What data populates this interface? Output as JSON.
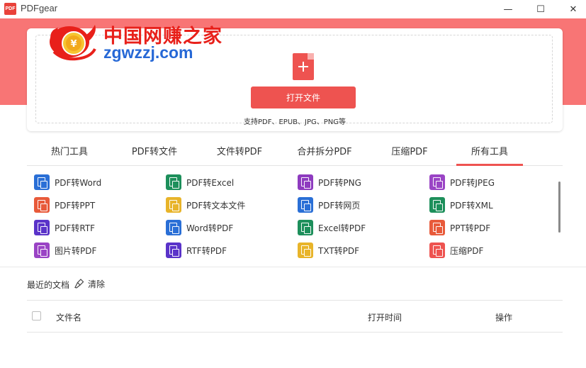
{
  "window": {
    "logo_text": "PDF",
    "title": "PDFgear",
    "minimize": "—",
    "maximize": "☐",
    "close": "✕"
  },
  "watermark": {
    "line1": "中国网赚之家",
    "line2": "zgwzzj.com"
  },
  "upload": {
    "open_button": "打开文件",
    "support_text": "支持PDF、EPUB、JPG、PNG等"
  },
  "tabs": [
    {
      "label": "热门工具"
    },
    {
      "label": "PDF转文件"
    },
    {
      "label": "文件转PDF"
    },
    {
      "label": "合并拆分PDF"
    },
    {
      "label": "压缩PDF"
    },
    {
      "label": "所有工具",
      "active": true
    }
  ],
  "tools": [
    {
      "label": "PDF转Word",
      "icon": "pdf-to-word-icon",
      "color": "#2a6fd6"
    },
    {
      "label": "PDF转Excel",
      "icon": "pdf-to-excel-icon",
      "color": "#1d8f5b"
    },
    {
      "label": "PDF转PNG",
      "icon": "pdf-to-png-icon",
      "color": "#8e3bbf"
    },
    {
      "label": "PDF转JPEG",
      "icon": "pdf-to-jpeg-icon",
      "color": "#9a44c5"
    },
    {
      "label": "PDF转PPT",
      "icon": "pdf-to-ppt-icon",
      "color": "#e85a3a"
    },
    {
      "label": "PDF转文本文件",
      "icon": "pdf-to-text-icon",
      "color": "#e8b42a"
    },
    {
      "label": "PDF转网页",
      "icon": "pdf-to-html-icon",
      "color": "#2a6fd6"
    },
    {
      "label": "PDF转XML",
      "icon": "pdf-to-xml-icon",
      "color": "#1d8f5b"
    },
    {
      "label": "PDF转RTF",
      "icon": "pdf-to-rtf-icon",
      "color": "#5a33c9"
    },
    {
      "label": "Word转PDF",
      "icon": "word-to-pdf-icon",
      "color": "#2a6fd6"
    },
    {
      "label": "Excel转PDF",
      "icon": "excel-to-pdf-icon",
      "color": "#1d8f5b"
    },
    {
      "label": "PPT转PDF",
      "icon": "ppt-to-pdf-icon",
      "color": "#e85a3a"
    },
    {
      "label": "图片转PDF",
      "icon": "image-to-pdf-icon",
      "color": "#9a44c5"
    },
    {
      "label": "RTF转PDF",
      "icon": "rtf-to-pdf-icon",
      "color": "#5a33c9"
    },
    {
      "label": "TXT转PDF",
      "icon": "txt-to-pdf-icon",
      "color": "#e8b42a"
    },
    {
      "label": "压缩PDF",
      "icon": "compress-pdf-icon",
      "color": "#ee5350"
    }
  ],
  "recent": {
    "label": "最近的文档",
    "clear": "清除",
    "columns": {
      "filename": "文件名",
      "open_time": "打开时间",
      "actions": "操作"
    }
  },
  "colors": {
    "accent": "#ee5350",
    "banner": "#f87575"
  }
}
